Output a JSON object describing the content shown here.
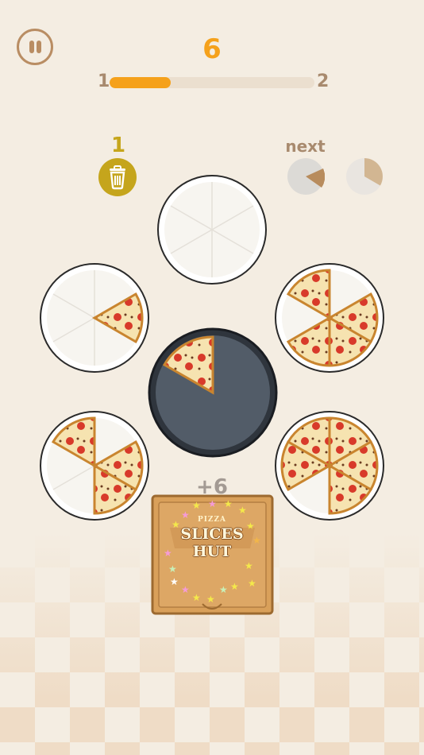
{
  "score": "6",
  "level": {
    "current": "1",
    "next": "2",
    "progress": 0.3
  },
  "trash": {
    "count": "1",
    "icon": "trash-icon"
  },
  "next": {
    "label": "next"
  },
  "box": {
    "bonus": "+6",
    "brand_top": "PIZZA",
    "brand_name": "SLICES HUT"
  },
  "colors": {
    "accent": "#f5a11b",
    "muted": "#a88a6e",
    "trash": "#c5a51c",
    "background": "#f4ede2"
  }
}
